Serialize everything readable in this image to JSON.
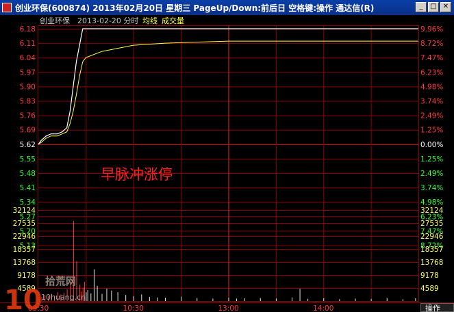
{
  "window": {
    "title": "创业环保(600874) 2013年02月20日 星期三 PageUp/Down:前后日 空格键:操作 通达信(R)",
    "buttons": {
      "minimize": "_",
      "maximize": "□",
      "close": "✕"
    }
  },
  "chart_header": {
    "stock_name": "创业环保",
    "date_label": "2013-02-20 分时",
    "avg_label": "均线",
    "volume_label": "成交量"
  },
  "annotation": "早脉冲涨停",
  "corner_button": "操作",
  "watermark": {
    "number": "10",
    "site": "拾荒网",
    "url": "10huang.cn"
  },
  "colors": {
    "background": "#000000",
    "up": "#ff3b3b",
    "down": "#33ff33",
    "price_line": "#ffffff",
    "avg_line": "#ffff44",
    "grid": "#8a0000",
    "volume_label": "#ffff66"
  },
  "chart_data": [
    {
      "type": "line",
      "title": "",
      "prev_close": 5.62,
      "ylim": [
        5.06,
        6.18
      ],
      "left_ticks": [
        "6.18",
        "6.11",
        "6.04",
        "5.97",
        "5.90",
        "5.83",
        "5.76",
        "5.69",
        "5.62",
        "5.55",
        "5.48",
        "5.41",
        "5.34",
        "5.27",
        "5.20",
        "5.13"
      ],
      "right_ticks": [
        "9.96%",
        "8.72%",
        "7.47%",
        "6.23%",
        "4.98%",
        "3.74%",
        "2.49%",
        "1.25%",
        "0.00%",
        "1.25%",
        "2.49%",
        "3.74%",
        "4.98%",
        "6.23%",
        "7.47%",
        "8.72%"
      ],
      "x_ticks": [
        "09:30",
        "10:30",
        "13:00",
        "14:00"
      ],
      "series": [
        {
          "name": "",
          "x": [
            0,
            2,
            5,
            8,
            12,
            15,
            18,
            20,
            22,
            24,
            26,
            28,
            30,
            35,
            240
          ],
          "values": [
            5.62,
            5.64,
            5.66,
            5.67,
            5.67,
            5.68,
            5.7,
            5.78,
            5.9,
            6.02,
            6.1,
            6.18,
            6.18,
            6.18,
            6.18
          ]
        },
        {
          "name": "均线",
          "x": [
            0,
            2,
            5,
            8,
            12,
            15,
            18,
            20,
            22,
            24,
            26,
            28,
            30,
            40,
            60,
            80,
            120,
            180,
            240
          ],
          "values": [
            5.62,
            5.63,
            5.65,
            5.66,
            5.66,
            5.67,
            5.68,
            5.72,
            5.78,
            5.86,
            5.95,
            6.02,
            6.04,
            6.07,
            6.1,
            6.11,
            6.12,
            6.12,
            6.12
          ]
        }
      ]
    },
    {
      "type": "bar",
      "title": "",
      "ylabel": "",
      "ylim": [
        0,
        33000
      ],
      "y_ticks": [
        "32124",
        "27535",
        "22946",
        "18357",
        "13768",
        "9178",
        "4589"
      ],
      "x": [
        2,
        4,
        6,
        8,
        10,
        12,
        14,
        16,
        18,
        20,
        22,
        24,
        26,
        27,
        28,
        29,
        30,
        31,
        33,
        35,
        37,
        40,
        43,
        46,
        50,
        55,
        60,
        65,
        70,
        75,
        80,
        90,
        100,
        110,
        120,
        125,
        130,
        140,
        150,
        160,
        165,
        170,
        180,
        190,
        200,
        210,
        220,
        230,
        238
      ],
      "values": [
        1500,
        2200,
        1800,
        2600,
        2000,
        3200,
        2400,
        3000,
        4200,
        6500,
        29000,
        14500,
        6000,
        3500,
        4800,
        7000,
        3200,
        4000,
        2800,
        11500,
        5500,
        2600,
        4500,
        3800,
        3200,
        2200,
        1800,
        2400,
        1500,
        1300,
        1200,
        1600,
        1100,
        900,
        1200,
        900,
        1000,
        1100,
        900,
        1300,
        4400,
        800,
        1000,
        700,
        900,
        800,
        1100,
        700,
        1000
      ]
    }
  ]
}
